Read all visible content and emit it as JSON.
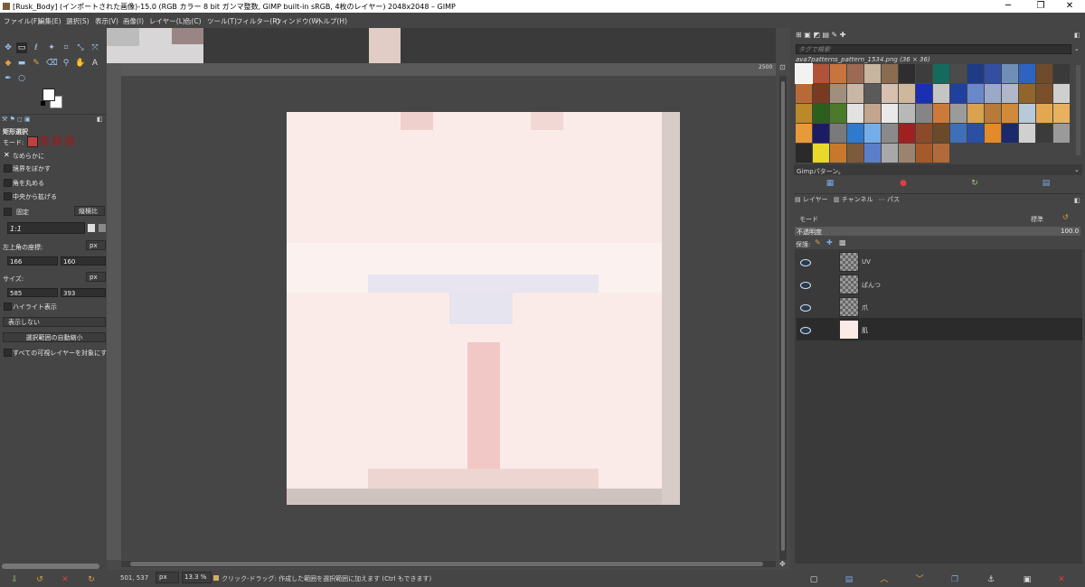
{
  "window": {
    "title": "[Rusk_Body] (インポートされた画像)-15.0 (RGB カラー 8 bit ガンマ整数, GIMP built-in sRGB, 4枚のレイヤー) 2048x2048 – GIMP",
    "minimize": "─",
    "maximize": "❐",
    "close": "✕"
  },
  "menu": [
    "ファイル(F)",
    "編集(E)",
    "選択(S)",
    "表示(V)",
    "画像(I)",
    "レイヤー(L)",
    "色(C)",
    "ツール(T)",
    "フィルター(R)",
    "ウィンドウ(W)",
    "ヘルプ(H)"
  ],
  "tool_options": {
    "title": "矩形選択",
    "mode_label": "モード:",
    "antialias": "なめらかに",
    "feather": "境界をぼかす",
    "rounded": "角を丸める",
    "expand_center": "中央から拡げる",
    "fixed": "固定",
    "fixed_type": "縦横比",
    "ratio": "1:1",
    "position_label": "左上角の座標:",
    "position_unit": "px",
    "pos_x": "166",
    "pos_y": "160",
    "size_label": "サイズ:",
    "size_unit": "px",
    "size_w": "585",
    "size_h": "393",
    "highlight": "ハイライト表示",
    "guides": "表示しない",
    "auto_shrink": "選択範囲の自動縮小",
    "shrink_merged": "すべての可視レイヤーを対象にす"
  },
  "canvas": {
    "ruler_value": "2500"
  },
  "status": {
    "coords": "501, 537",
    "unit": "px",
    "zoom": "13.3 %",
    "message": "クリック-ドラッグ: 作成した範囲を選択範囲に加えます (Ctrl もできます)"
  },
  "patterns": {
    "search_placeholder": "タグで検索",
    "current": "ava7patterns_pattern_1534.png (36 × 36)",
    "footer": "Gimpパターン。",
    "colors": [
      "#f2f2f2",
      "#b0533a",
      "#c8743e",
      "#9c6a52",
      "#c7b59f",
      "#8a6c50",
      "#2e2e2e",
      "#3d3d3d",
      "#146b5d",
      "#4b4b4b",
      "#1f3b86",
      "#334fa3",
      "#6f8fb8",
      "#2f63c1",
      "#6e4b2a",
      "#3a3a3a",
      "#b86a36",
      "#7a3a22",
      "#a08f7c",
      "#c9b7a5",
      "#5a5a5a",
      "#d6c0b0",
      "#cdb89b",
      "#1a2fb3",
      "#c5c5c5",
      "#2040a0",
      "#6a88c9",
      "#9aa9c7",
      "#b1b7c8",
      "#92652b",
      "#7b4f2c",
      "#cfcfcf",
      "#b9892a",
      "#2b5f1e",
      "#4a7a2a",
      "#e2e2e2",
      "#c3a48c",
      "#e9e9e9",
      "#b8b8b8",
      "#858585",
      "#cc7a3a",
      "#9b9b9b",
      "#d9a24f",
      "#b77a3b",
      "#d08a3a",
      "#b8c9d9",
      "#e1a84f",
      "#e7b160",
      "#e79a3a",
      "#1c1c66",
      "#7a7a7a",
      "#2f7acc",
      "#73aee8",
      "#8a8a8a",
      "#a02020",
      "#8c4a2a",
      "#6b4a2a",
      "#3e6fb8",
      "#2a4fa3",
      "#e58a2a",
      "#1a2a6a",
      "#d0d0d0",
      "#3b3b3b",
      "#9a9a9a",
      "#2a2a2a",
      "#e8d82a",
      "#c8782a",
      "#7d5a3c",
      "#5b7ec9",
      "#a8a8a8",
      "#9a8470",
      "#a45a2a",
      "#b36a3a"
    ]
  },
  "layers_panel": {
    "tabs": [
      "レイヤー",
      "チャンネル",
      "パス"
    ],
    "mode_label": "モード",
    "mode_value": "標準",
    "opacity_label": "不透明度",
    "opacity_value": "100.0",
    "lock_label": "保護:",
    "layers": [
      {
        "name": "UV",
        "selected": false,
        "solid": false
      },
      {
        "name": "ぱんつ",
        "selected": false,
        "solid": false
      },
      {
        "name": "爪",
        "selected": false,
        "solid": false
      },
      {
        "name": "肌",
        "selected": true,
        "solid": true
      }
    ]
  },
  "colors": {
    "bg": "#454545",
    "canvas": "#494949",
    "image_base": "#fbebe8",
    "accent_blue": "#9ec8f2",
    "selected_row": "#2b2b2b"
  }
}
